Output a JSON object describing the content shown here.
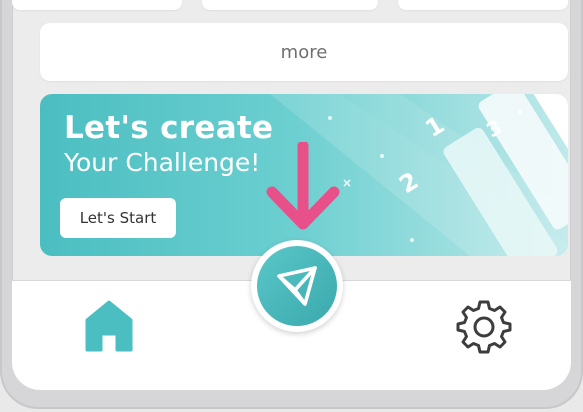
{
  "list": {
    "more_label": "more"
  },
  "banner": {
    "title": "Let's create",
    "subtitle": "Your Challenge!",
    "button_label": "Let's Start",
    "step_numbers": [
      "1",
      "2",
      "3"
    ]
  },
  "nav": {
    "home_icon": "home-icon",
    "create_icon": "paper-plane-icon",
    "settings_icon": "gear-icon",
    "accent_color": "#4bbec1",
    "arrow_color": "#e8508a"
  }
}
